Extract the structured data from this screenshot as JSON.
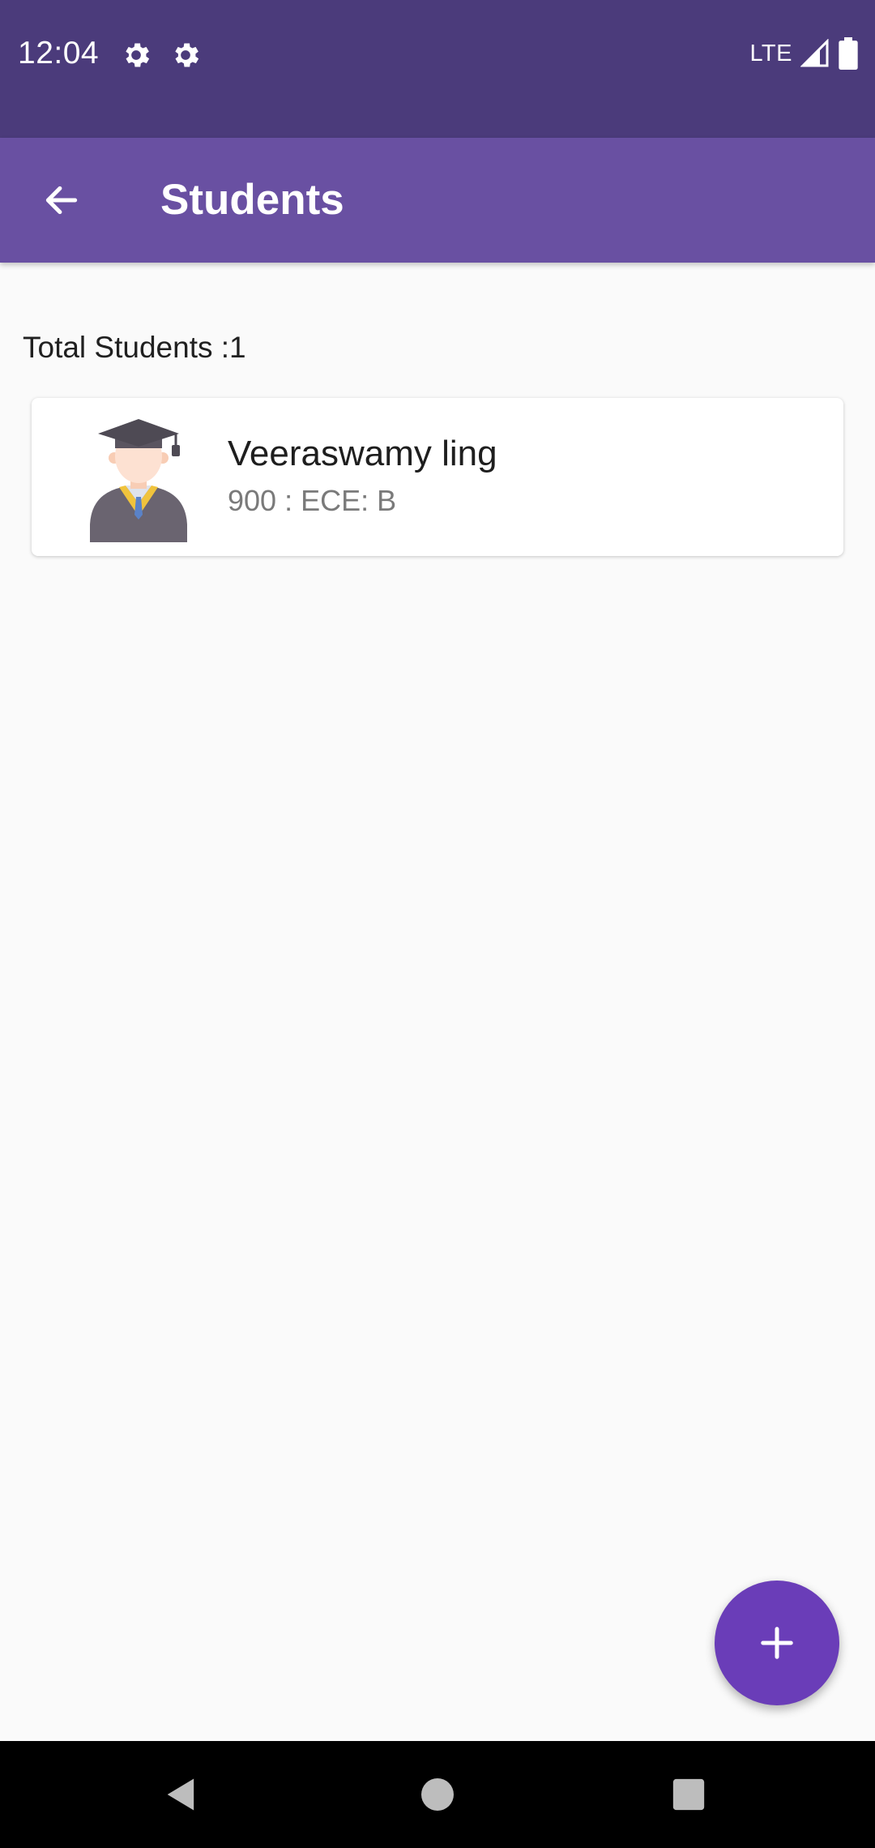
{
  "status_bar": {
    "time": "12:04",
    "network": "LTE",
    "icons": [
      "gear-icon",
      "gear-icon",
      "signal-icon",
      "battery-icon"
    ]
  },
  "app_bar": {
    "title": "Students",
    "back_icon": "arrow-left-icon"
  },
  "summary": {
    "total_label": "Total Students :1"
  },
  "students": [
    {
      "name": "Veeraswamy ling",
      "detail": "900 : ECE: B",
      "avatar_icon": "graduate-avatar-icon"
    }
  ],
  "fab": {
    "icon": "plus-icon"
  },
  "nav_bar": {
    "icons": [
      "back-triangle-icon",
      "home-circle-icon",
      "recents-square-icon"
    ]
  },
  "colors": {
    "status_bar": "#4b3b7b",
    "app_bar": "#6950a2",
    "fab": "#6a3db8",
    "background": "#fafafa"
  }
}
